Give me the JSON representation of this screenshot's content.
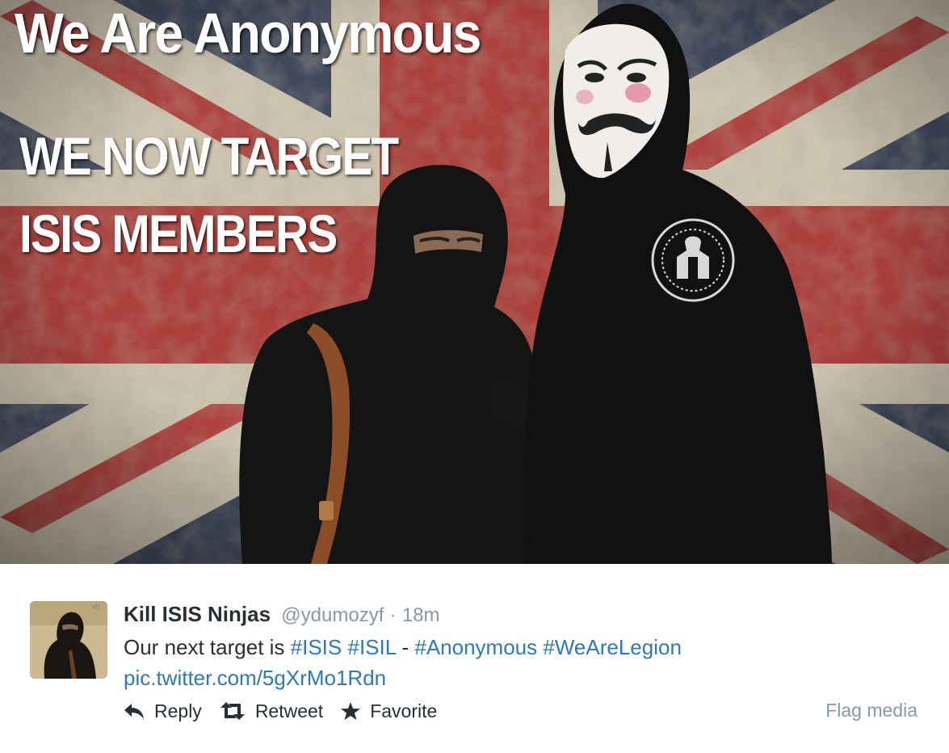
{
  "media": {
    "headline": "We Are Anonymous",
    "line1": "WE NOW TARGET",
    "line2": "ISIS MEMBERS"
  },
  "tweet": {
    "display_name": "Kill ISIS Ninjas",
    "username": "@ydumozyf",
    "separator": "·",
    "timestamp": "18m",
    "text_prefix": "Our next target is",
    "hashtags": [
      "#ISIS",
      "#ISIL",
      "#Anonymous",
      "#WeAreLegion"
    ],
    "dash": "-",
    "pic_link": "pic.twitter.com/5gXrMo1Rdn"
  },
  "actions": {
    "reply": "Reply",
    "retweet": "Retweet",
    "favorite": "Favorite",
    "flag": "Flag media"
  },
  "icons": {
    "reply": "reply-arrow-icon",
    "retweet": "retweet-icon",
    "favorite": "star-icon"
  },
  "colors": {
    "link": "#2b7bb9",
    "name": "#292f33",
    "muted": "#8899a6"
  }
}
